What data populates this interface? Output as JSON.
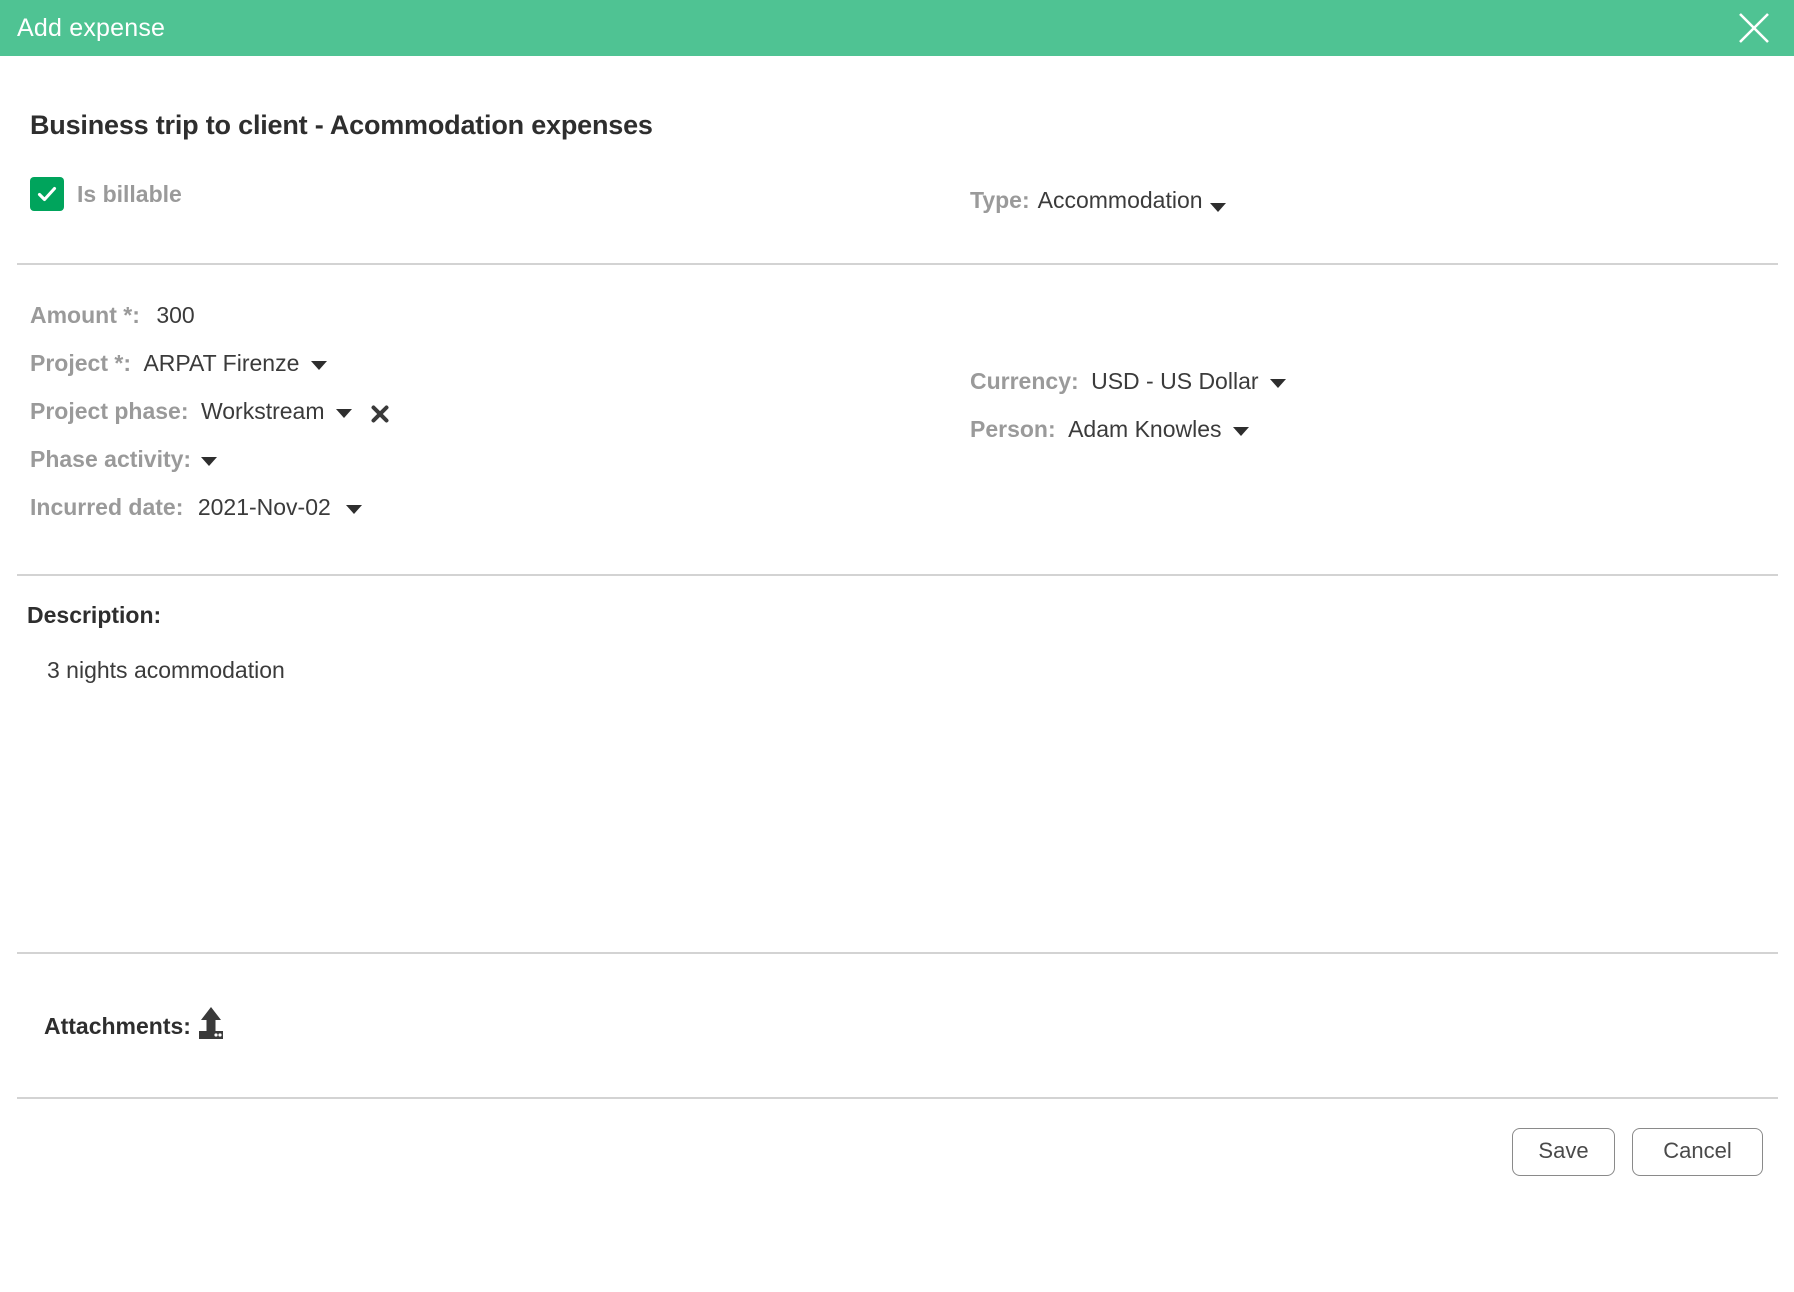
{
  "header": {
    "title": "Add expense",
    "close_icon": "close-icon",
    "background_color": "#4fc393"
  },
  "record": {
    "title": "Business trip to client - Acommodation expenses"
  },
  "billable": {
    "label": "Is billable",
    "checked": true,
    "checkbox_color": "#00a45c",
    "check_icon": "check-icon"
  },
  "fields": {
    "type": {
      "label": "Type:",
      "value": "Accommodation",
      "caret_icon": "chevron-down-icon"
    },
    "amount": {
      "label": "Amount *:",
      "value": "300"
    },
    "project": {
      "label": "Project *:",
      "value": "ARPAT Firenze",
      "caret_icon": "chevron-down-icon"
    },
    "project_phase": {
      "label": "Project phase:",
      "value": "Workstream",
      "caret_icon": "chevron-down-icon",
      "clear_icon": "clear-x-icon"
    },
    "phase_activity": {
      "label": "Phase activity:",
      "value": "",
      "caret_icon": "chevron-down-icon"
    },
    "incurred_date": {
      "label": "Incurred date:",
      "value": "2021-Nov-02",
      "caret_icon": "chevron-down-icon"
    },
    "currency": {
      "label": "Currency:",
      "value": "USD - US Dollar",
      "caret_icon": "chevron-down-icon"
    },
    "person": {
      "label": "Person:",
      "value": "Adam Knowles",
      "caret_icon": "chevron-down-icon"
    }
  },
  "description": {
    "label": "Description:",
    "text": "3 nights acommodation"
  },
  "attachments": {
    "label": "Attachments:",
    "upload_icon": "upload-icon"
  },
  "footer": {
    "save_label": "Save",
    "cancel_label": "Cancel"
  }
}
